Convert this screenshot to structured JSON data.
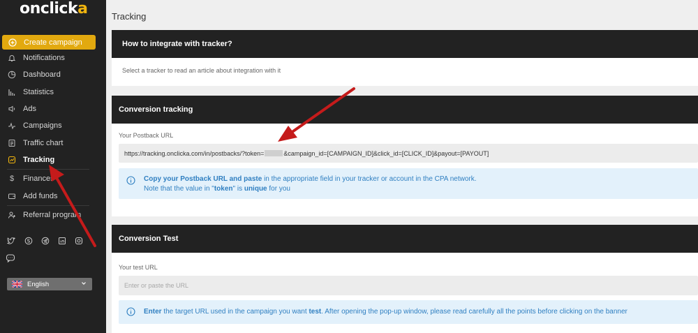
{
  "brand": {
    "logo_main": "onclick",
    "logo_accent": "a"
  },
  "sidebar": {
    "items": [
      {
        "label": "Create campaign",
        "icon": "plus-circle-icon"
      },
      {
        "label": "Notifications",
        "icon": "bell-icon"
      },
      {
        "label": "Dashboard",
        "icon": "pie-icon"
      },
      {
        "label": "Statistics",
        "icon": "bar-chart-icon"
      },
      {
        "label": "Ads",
        "icon": "megaphone-icon"
      },
      {
        "label": "Campaigns",
        "icon": "pulse-icon"
      },
      {
        "label": "Traffic chart",
        "icon": "document-icon"
      },
      {
        "label": "Tracking",
        "icon": "tracking-icon"
      },
      {
        "label": "Finances",
        "icon": "dollar-icon"
      },
      {
        "label": "Add funds",
        "icon": "wallet-icon"
      },
      {
        "label": "Referral program",
        "icon": "user-plus-icon"
      }
    ],
    "language": "English",
    "accent_color": "#e2a90f"
  },
  "page": {
    "title": "Tracking"
  },
  "integrate": {
    "title": "How to integrate with tracker?",
    "subtitle": "Select a tracker to read an article about integration with it"
  },
  "conversion": {
    "title": "Conversion tracking",
    "label": "Your Postback URL",
    "url_prefix": "https://tracking.onclicka.com/in/postbacks/?token=",
    "url_suffix": "&campaign_id=[CAMPAIGN_ID]&click_id=[CLICK_ID]&payout=[PAYOUT]",
    "info": {
      "b1": "Copy your Postback URL and paste",
      "t1": " in the appropriate field in your tracker or account in the CPA network.",
      "t2": "Note that the value in \"",
      "b2": "token",
      "t3": "\" is ",
      "b3": "unique",
      "t4": " for you"
    }
  },
  "test": {
    "title": "Conversion Test",
    "label": "Your test URL",
    "placeholder": "Enter or paste the URL",
    "info": {
      "b1": "Enter",
      "t1": " the target URL used in the campaign you want ",
      "b2": "test",
      "t2": ". After opening the pop-up window, please read carefully all the points before clicking on the banner"
    }
  }
}
